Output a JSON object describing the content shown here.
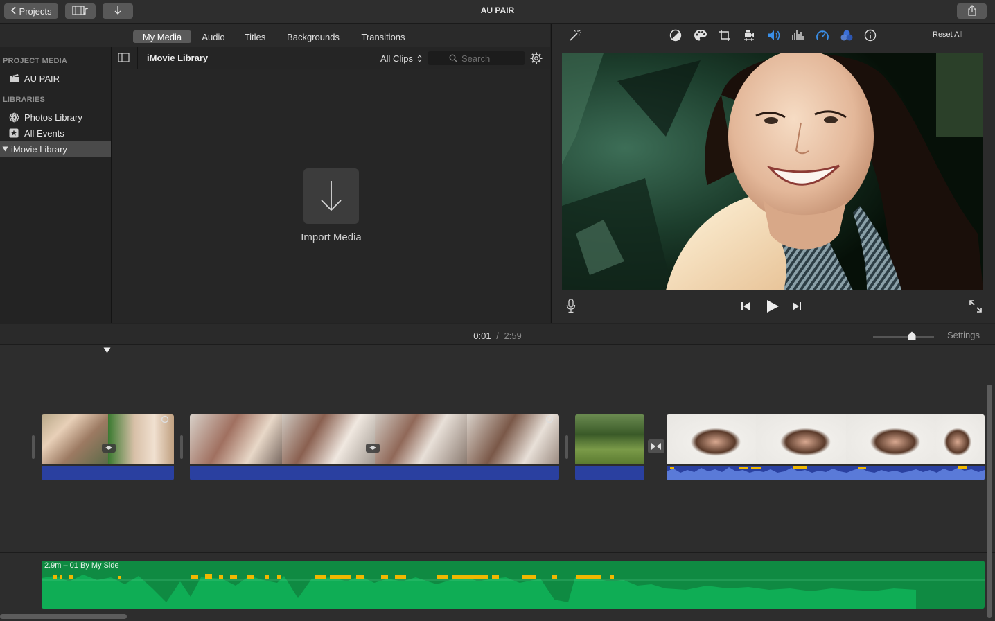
{
  "window": {
    "title": "AU PAIR"
  },
  "toolbar": {
    "projects_label": "Projects"
  },
  "browser_tabs": [
    {
      "label": "My Media",
      "active": true
    },
    {
      "label": "Audio",
      "active": false
    },
    {
      "label": "Titles",
      "active": false
    },
    {
      "label": "Backgrounds",
      "active": false
    },
    {
      "label": "Transitions",
      "active": false
    }
  ],
  "sidebar": {
    "project_media_header": "PROJECT MEDIA",
    "project_item": "AU PAIR",
    "libraries_header": "LIBRARIES",
    "libraries": [
      {
        "label": "Photos Library",
        "icon": "flower-icon"
      },
      {
        "label": "All Events",
        "icon": "star-icon"
      }
    ],
    "selected_library": "iMovie Library"
  },
  "media_bar": {
    "library_name": "iMovie Library",
    "filter": "All Clips",
    "search_placeholder": "Search"
  },
  "import": {
    "label": "Import Media"
  },
  "adjust_bar": {
    "reset_label": "Reset All",
    "accent": "#3a8fe8"
  },
  "timecode": {
    "current": "0:01",
    "separator": "/",
    "total": "2:59"
  },
  "timeline": {
    "settings_label": "Settings",
    "music_clip_label": "2.9m – 01 By My Side"
  }
}
